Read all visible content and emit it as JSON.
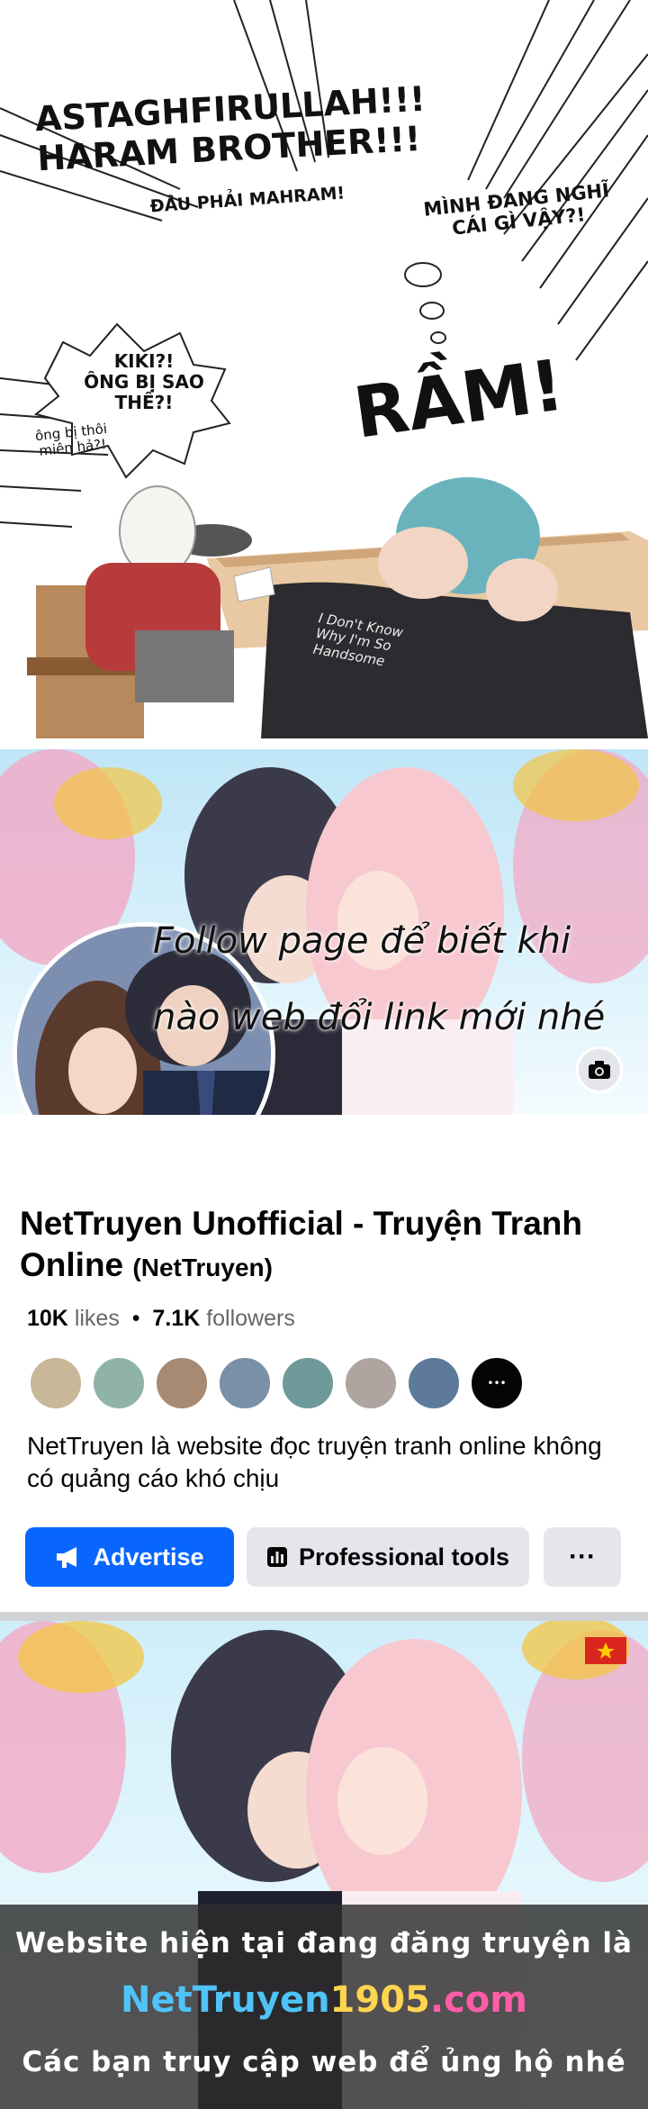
{
  "comic": {
    "shout_line1": "ASTAGHFIRULLAH!!!",
    "shout_line2": "HARAM BROTHER!!!",
    "sub_line": "ĐÂU PHẢI MAHRAM!",
    "thought_line1": "MÌNH ĐANG NGHĨ",
    "thought_line2": "CÁI GÌ VẬY?!",
    "kiki_line1": "KIKI?!",
    "kiki_line2": "ÔNG BỊ SAO",
    "kiki_line3": "THẾ?!",
    "small_line1": "ông bị thôi",
    "small_line2": "miên hả?!",
    "sfx": "RẦM!",
    "shirt_line1": "I Don't Know",
    "shirt_line2": "Why I'm So",
    "shirt_line3": "Handsome"
  },
  "banner": {
    "overlay_line1": "Follow page để biết khi",
    "overlay_line2": "nào web đổi link mới nhé",
    "camera_icon": "camera-icon"
  },
  "profile": {
    "name": "NetTruyen Unofficial - Truyện Tranh Online",
    "handle": "(NetTruyen)",
    "likes_count": "10K",
    "likes_label": "likes",
    "separator": "•",
    "followers_count": "7.1K",
    "followers_label": "followers",
    "more_friends": "•••",
    "description": "NetTruyen là website đọc truyện tranh online không có quảng cáo khó chịu",
    "advertise_label": "Advertise",
    "professional_tools_label": "Professional tools",
    "more_label": "···"
  },
  "ad": {
    "line1": "Website hiện tại đang đăng truyện là",
    "url_part1": "NetTruyen",
    "url_part2": "1905",
    "url_part3": ".com",
    "line3": "Các bạn truy cập web để ủng hộ nhé"
  },
  "colors": {
    "fb_blue": "#0866ff",
    "secondary_gray": "#e4e6eb",
    "text_dark": "#050505",
    "text_muted": "#65676b"
  }
}
